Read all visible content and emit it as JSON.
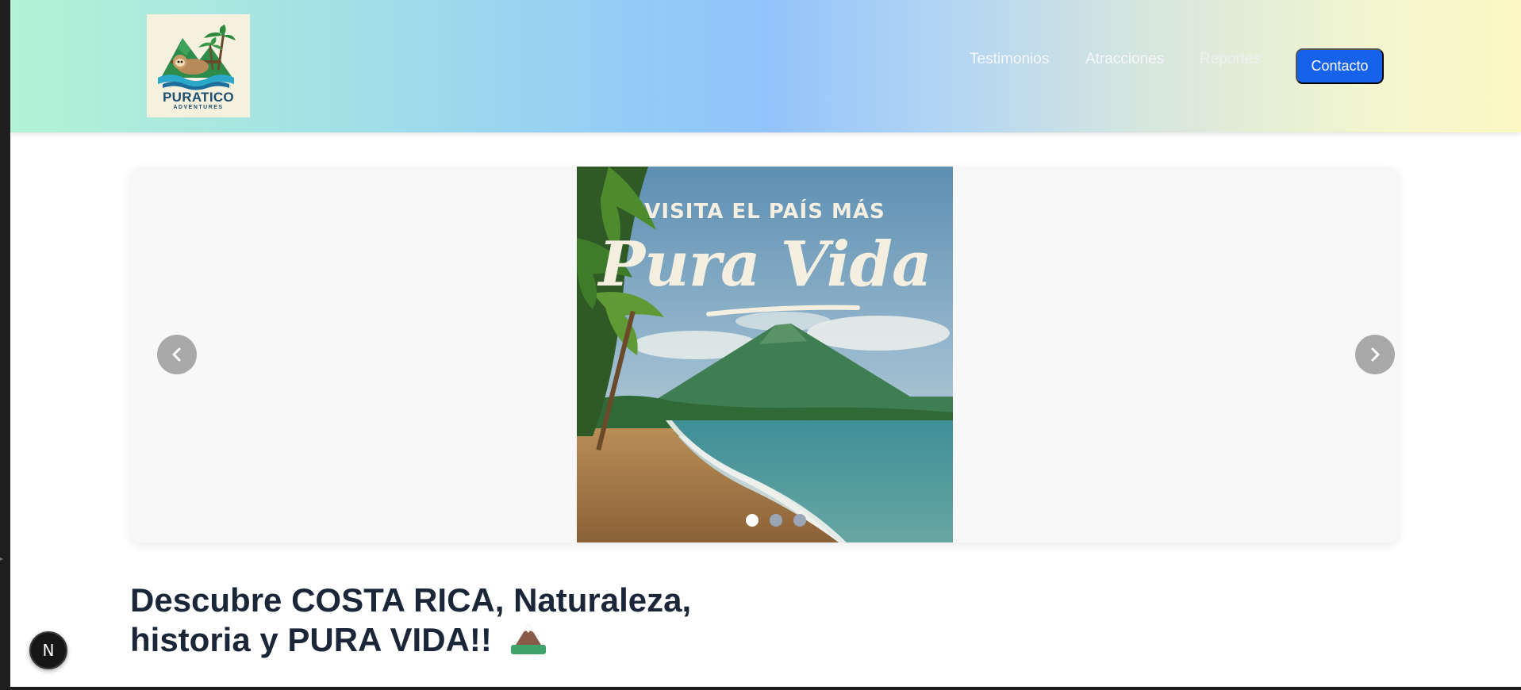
{
  "header": {
    "logo": {
      "brand": "PURATICO",
      "sub": "ADVENTURES",
      "icon": "sloth-palm-logo"
    },
    "nav": [
      {
        "label": "Testimonios"
      },
      {
        "label": "Atracciones"
      },
      {
        "label": "Reportes"
      }
    ],
    "cta_label": "Contacto"
  },
  "carousel": {
    "slide_caption_top": "VISITA EL PAÍS MÁS",
    "slide_caption_main": "Pura Vida",
    "prev_icon": "chevron-left-icon",
    "next_icon": "chevron-right-icon",
    "dots": {
      "count": 3,
      "active_index": 0
    }
  },
  "headline": {
    "line1": "Descubre COSTA RICA, Naturaleza,",
    "line2": "historia y PURA VIDA!!",
    "emoji": "mountain-icon"
  },
  "dev_badge": {
    "label": "N"
  },
  "colors": {
    "cta": "#1762ea",
    "headline": "#1b2638",
    "carousel_bg": "#f8f8f8",
    "arrow_bg": "#a9a9a9"
  }
}
